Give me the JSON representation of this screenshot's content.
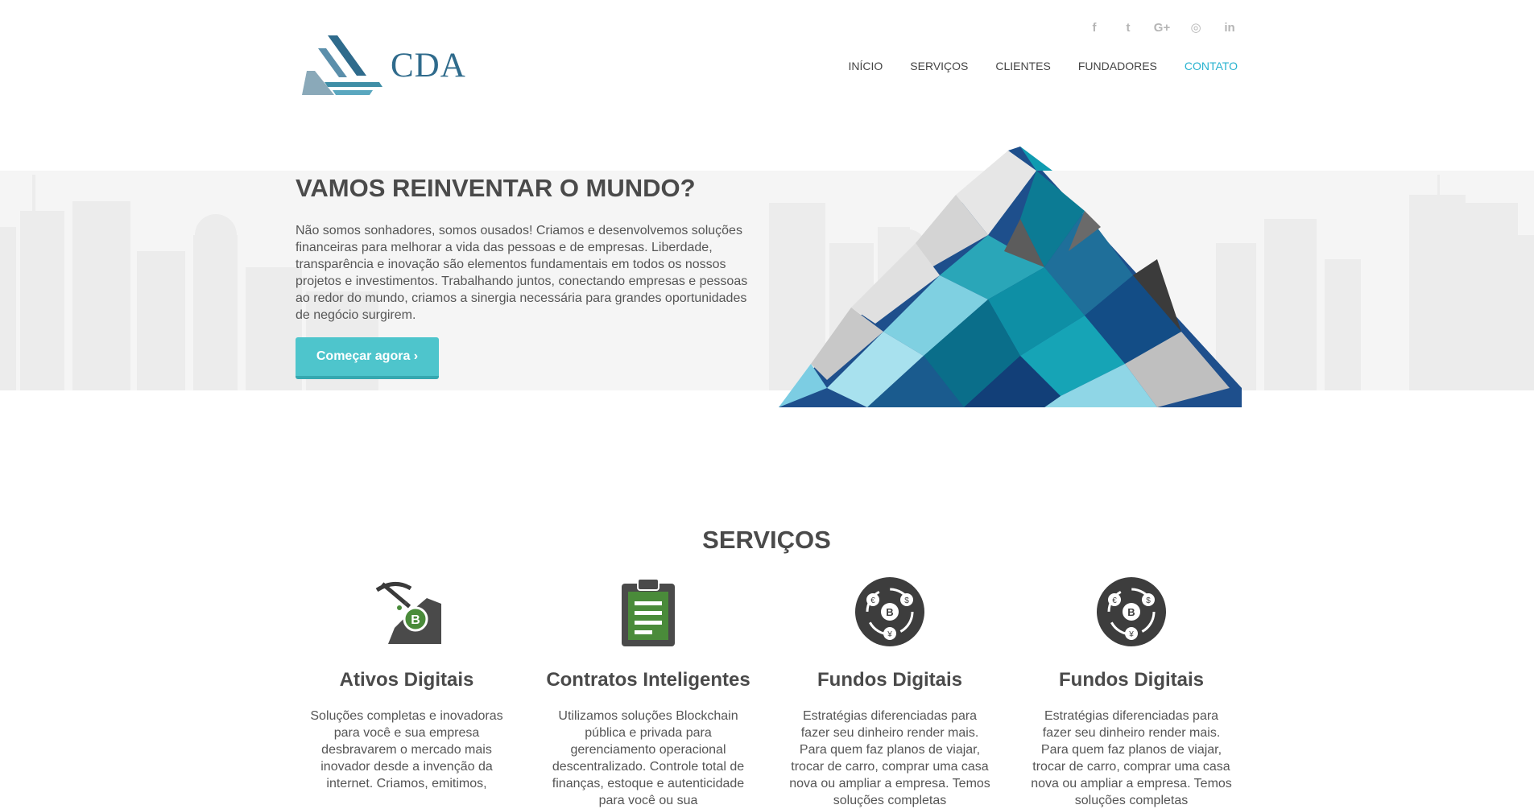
{
  "header": {
    "brand": "CDA",
    "social": [
      {
        "icon": "facebook-icon",
        "glyph": "f"
      },
      {
        "icon": "twitter-icon",
        "glyph": "t"
      },
      {
        "icon": "google-plus-icon",
        "glyph": "G+"
      },
      {
        "icon": "dribbble-icon",
        "glyph": "◎"
      },
      {
        "icon": "linkedin-icon",
        "glyph": "in"
      }
    ],
    "nav": [
      {
        "label": "INÍCIO",
        "active": false
      },
      {
        "label": "SERVIÇOS",
        "active": false
      },
      {
        "label": "CLIENTES",
        "active": false
      },
      {
        "label": "FUNDADORES",
        "active": false
      },
      {
        "label": "CONTATO",
        "active": true
      }
    ]
  },
  "hero": {
    "title": "VAMOS REINVENTAR O MUNDO?",
    "text": "Não somos sonhadores, somos ousados! Criamos e desenvolvemos soluções financeiras para melhorar a vida das pessoas e de empresas. Liberdade, transparência e inovação são elementos fundamentais em todos os nossos projetos e investimentos. Trabalhando juntos, conectando empresas e pessoas ao redor do mundo, criamos a sinergia necessária para grandes oportunidades de negócio surgirem.",
    "cta": "Começar agora ›"
  },
  "services": {
    "title": "SERVIÇOS",
    "items": [
      {
        "icon": "mining-pickaxe-icon",
        "title": "Ativos Digitais",
        "text": "Soluções completas e inovadoras para você e sua empresa desbravarem o mercado mais inovador desde a invenção da internet. Criamos, emitimos,"
      },
      {
        "icon": "clipboard-icon",
        "title": "Contratos Inteligentes",
        "text": "Utilizamos soluções Blockchain pública e privada para gerenciamento operacional descentralizado. Controle total de finanças, estoque e autenticidade para você ou sua"
      },
      {
        "icon": "crypto-exchange-icon",
        "title": "Fundos Digitais",
        "text": "Estratégias diferenciadas para fazer seu dinheiro render mais. Para quem faz planos de viajar, trocar de carro, comprar uma casa nova ou ampliar a empresa. Temos soluções completas"
      },
      {
        "icon": "crypto-exchange-icon",
        "title": "Fundos Digitais",
        "text": "Estratégias diferenciadas para fazer seu dinheiro render mais. Para quem faz planos de viajar, trocar de carro, comprar uma casa nova ou ampliar a empresa. Temos soluções completas"
      }
    ]
  },
  "colors": {
    "accent": "#27b2cf",
    "button": "#4ec5cc",
    "brand": "#2f6b8c",
    "heading": "#4a4a4a"
  }
}
